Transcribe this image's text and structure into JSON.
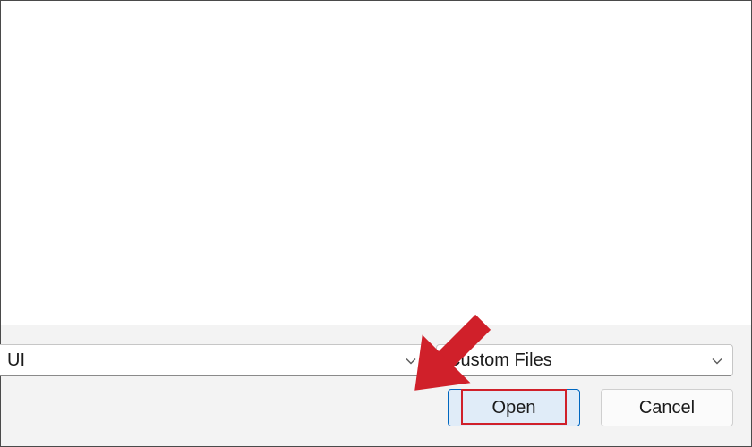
{
  "file_name_field": {
    "value": "UI"
  },
  "file_type_dropdown": {
    "selected": "Custom Files"
  },
  "buttons": {
    "open_label": "Open",
    "cancel_label": "Cancel"
  },
  "annotation": {
    "arrow_color": "#d0202a",
    "highlight_color": "#d0202a"
  }
}
